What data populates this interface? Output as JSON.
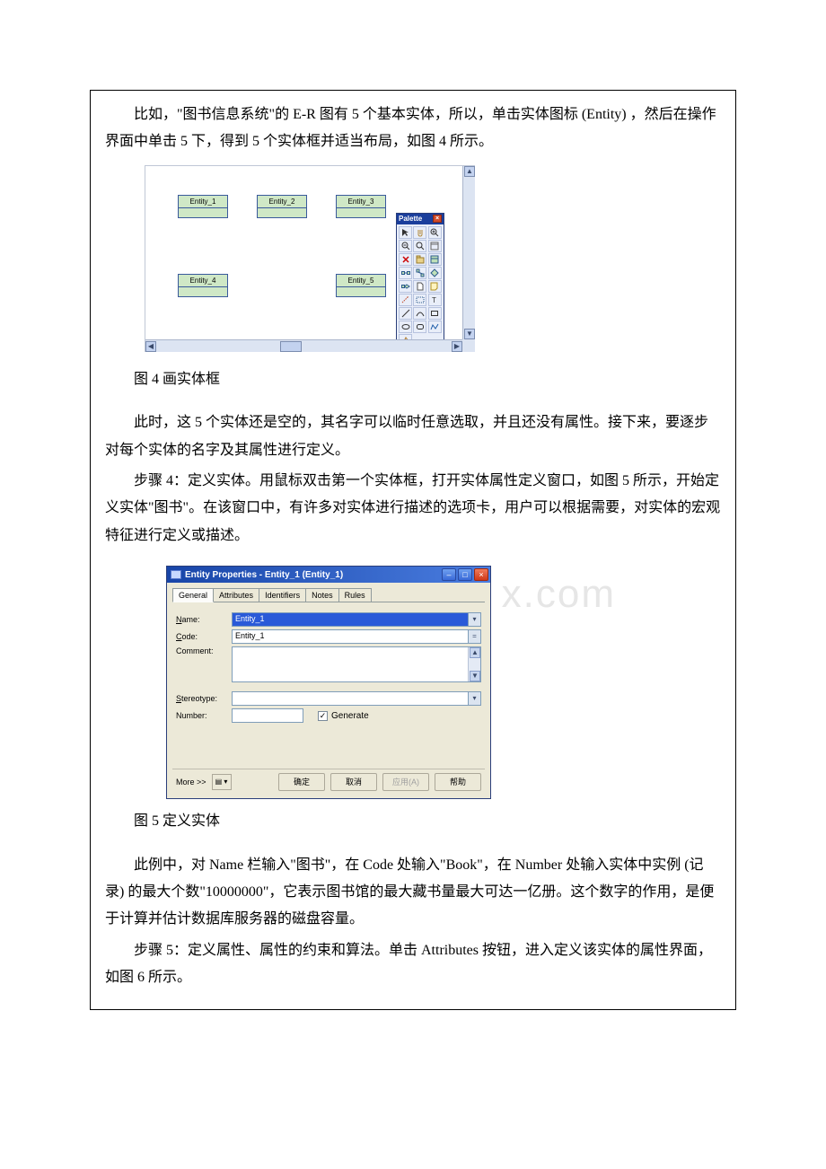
{
  "paragraphs": {
    "p1": "比如，\"图书信息系统\"的 E-R 图有 5 个基本实体，所以，单击实体图标 (Entity) ，然后在操作界面中单击 5 下，得到 5 个实体框并适当布局，如图 4 所示。",
    "cap4": "图 4 画实体框",
    "p2": "此时，这 5 个实体还是空的，其名字可以临时任意选取，并且还没有属性。接下来，要逐步对每个实体的名字及其属性进行定义。",
    "p3": "步骤 4：定义实体。用鼠标双击第一个实体框，打开实体属性定义窗口，如图 5 所示，开始定义实体\"图书\"。在该窗口中，有许多对实体进行描述的选项卡，用户可以根据需要，对实体的宏观特征进行定义或描述。",
    "cap5": "图 5 定义实体",
    "p4": "此例中，对 Name 栏输入\"图书\"，在 Code 处输入\"Book\"，在 Number 处输入实体中实例 (记录) 的最大个数\"10000000\"，它表示图书馆的最大藏书量最大可达一亿册。这个数字的作用，是便于计算并估计数据库服务器的磁盘容量。",
    "p5": "步骤 5：定义属性、属性的约束和算法。单击 Attributes 按钮，进入定义该实体的属性界面，如图 6 所示。"
  },
  "fig4": {
    "palette_title": "Palette",
    "entities": [
      {
        "label": "Entity_1"
      },
      {
        "label": "Entity_2"
      },
      {
        "label": "Entity_3"
      },
      {
        "label": "Entity_4"
      },
      {
        "label": "Entity_5"
      }
    ]
  },
  "fig5": {
    "title": "Entity Properties - Entity_1 (Entity_1)",
    "tabs": [
      "General",
      "Attributes",
      "Identifiers",
      "Notes",
      "Rules"
    ],
    "labels": {
      "name": "Name:",
      "code": "Code:",
      "comment": "Comment:",
      "stereotype": "Stereotype:",
      "number": "Number:",
      "generate": "Generate"
    },
    "values": {
      "name": "Entity_1",
      "code": "Entity_1",
      "comment": "",
      "stereotype": "",
      "number": ""
    },
    "footer": {
      "more": "More >>",
      "ok": "确定",
      "cancel": "取消",
      "apply": "应用(A)",
      "help": "帮助"
    }
  },
  "watermark": "x.com"
}
